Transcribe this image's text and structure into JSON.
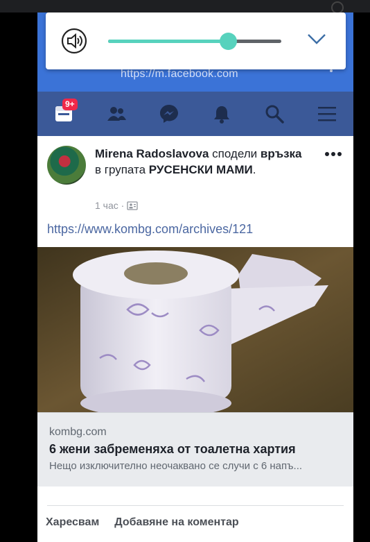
{
  "browser": {
    "url": "https://m.facebook.com"
  },
  "volume": {
    "level": 0.69
  },
  "nav": {
    "notifications_badge": "9+"
  },
  "post": {
    "author": "Mirena Radoslavova",
    "action_text": " сподели ",
    "shared_item": "връзка",
    "group_text": " в групата ",
    "group_name": "РУСЕНСКИ МАМИ",
    "period": ".",
    "time": "1 час ·",
    "url": "https://www.kombg.com/archives/121"
  },
  "link_preview": {
    "domain": "kombg.com",
    "title": "6 жени забременяха от тоалетна хартия",
    "description": "Нещо изключително неочаквано се случи с 6 напъ..."
  },
  "actions": {
    "like": "Харесвам",
    "comment": "Добавяне на коментар"
  },
  "colors": {
    "fb_blue": "#3b5998",
    "browser_blue": "#3b73d7",
    "slider_accent": "#57d2bd"
  }
}
